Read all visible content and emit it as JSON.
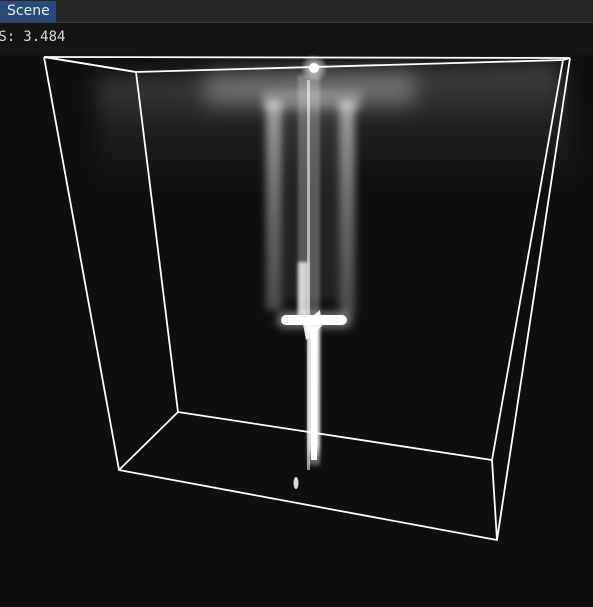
{
  "window": {
    "tab_label": "Scene"
  },
  "stats": {
    "fps_label": "PS:",
    "fps_value": "3.484"
  },
  "viewport": {
    "background_color": "#0f0f0f",
    "box_edge_color": "#ffffff"
  }
}
